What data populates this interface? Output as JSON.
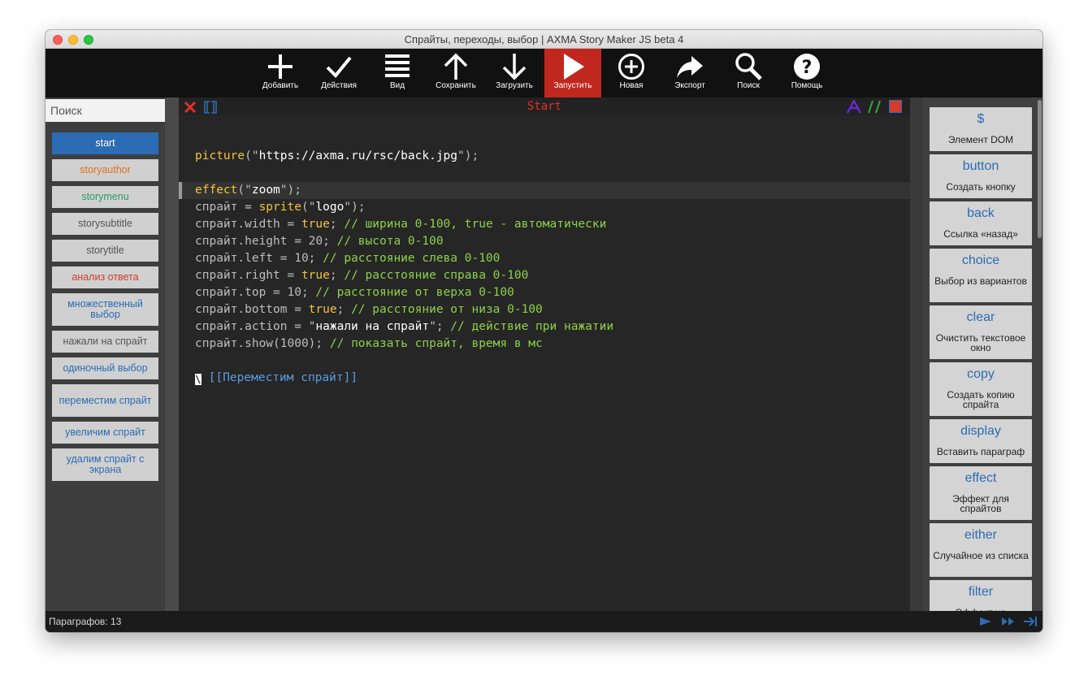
{
  "window": {
    "title": "Спрайты, переходы, выбор | AXMA Story Maker JS beta 4"
  },
  "toolbar": {
    "add": "Добавить",
    "actions": "Действия",
    "view": "Вид",
    "save": "Сохранить",
    "load": "Загрузить",
    "run": "Запустить",
    "new": "Новая",
    "export": "Экспорт",
    "search": "Поиск",
    "help": "Помощь"
  },
  "search": {
    "placeholder": "Поиск"
  },
  "passages": [
    {
      "label": "start",
      "color": "#ffffff"
    },
    {
      "label": "storyauthor",
      "color": "#e07020"
    },
    {
      "label": "storymenu",
      "color": "#2a9a6a"
    },
    {
      "label": "storysubtitle",
      "color": "#555555"
    },
    {
      "label": "storytitle",
      "color": "#555555"
    },
    {
      "label": "анализ ответа",
      "color": "#d63a2a"
    },
    {
      "label": "множественный выбор",
      "color": "#2b6cb4"
    },
    {
      "label": "нажали на спрайт",
      "color": "#555555"
    },
    {
      "label": "одиночный выбор",
      "color": "#2b6cb4"
    },
    {
      "label": "переместим спрайт",
      "color": "#2b6cb4"
    },
    {
      "label": "увеличим спрайт",
      "color": "#2b6cb4"
    },
    {
      "label": "удалим спрайт с экрана",
      "color": "#2b6cb4"
    }
  ],
  "editor": {
    "passage_title": "Start",
    "code": {
      "l1_fn": "picture",
      "l1_a": "(\"",
      "l1_s": "https://axma.ru/rsc/back.jpg",
      "l1_b": "\");",
      "l2_fn": "effect",
      "l2_a": "(\"",
      "l2_s": "zoom",
      "l2_b": "\");",
      "l3_a": "спрайт = ",
      "l3_fn": "sprite",
      "l3_b": "(\"",
      "l3_s": "logo",
      "l3_c": "\");",
      "l4_a": "спрайт.width = ",
      "l4_v": "true",
      "l4_b": "; ",
      "l4_c": "// ширина 0-100, true - автоматически",
      "l5_a": "спрайт.height = 20; ",
      "l5_c": "// высота 0-100",
      "l6_a": "спрайт.left = 10; ",
      "l6_c": "// расстояние слева 0-100",
      "l7_a": "спрайт.right = ",
      "l7_v": "true",
      "l7_b": "; ",
      "l7_c": "// расстояние справа 0-100",
      "l8_a": "спрайт.top = 10; ",
      "l8_c": "// расстояние от верха 0-100",
      "l9_a": "спрайт.bottom = ",
      "l9_v": "true",
      "l9_b": "; ",
      "l9_c": "// расстояние от низа 0-100",
      "l10_a": "спрайт.action = \"",
      "l10_s": "нажали на спрайт",
      "l10_b": "\"; ",
      "l10_c": "// действие при нажатии",
      "l11_a": "спрайт.show(1000); ",
      "l11_c": "// показать спрайт, время в мс",
      "l12_cursor": "\\",
      "l12_link": "[[Переместим спрайт]]"
    }
  },
  "macros": [
    {
      "name": "$",
      "desc": "Элемент DOM"
    },
    {
      "name": "button",
      "desc": "Создать кнопку"
    },
    {
      "name": "back",
      "desc": "Ссылка «назад»"
    },
    {
      "name": "choice",
      "desc": "Выбор из вариантов"
    },
    {
      "name": "clear",
      "desc": "Очистить текстовое окно"
    },
    {
      "name": "copy",
      "desc": "Создать копию спрайта"
    },
    {
      "name": "display",
      "desc": "Вставить параграф"
    },
    {
      "name": "effect",
      "desc": "Эффект для спрайтов"
    },
    {
      "name": "either",
      "desc": "Случайное из списка"
    },
    {
      "name": "filter",
      "desc": "Эффект на"
    }
  ],
  "status": {
    "count": "Параграфов: 13"
  },
  "colors": {
    "accent": "#2b6cb4",
    "run": "#c0281f",
    "comment": "#8cd14a",
    "keyword": "#f3c43c"
  }
}
